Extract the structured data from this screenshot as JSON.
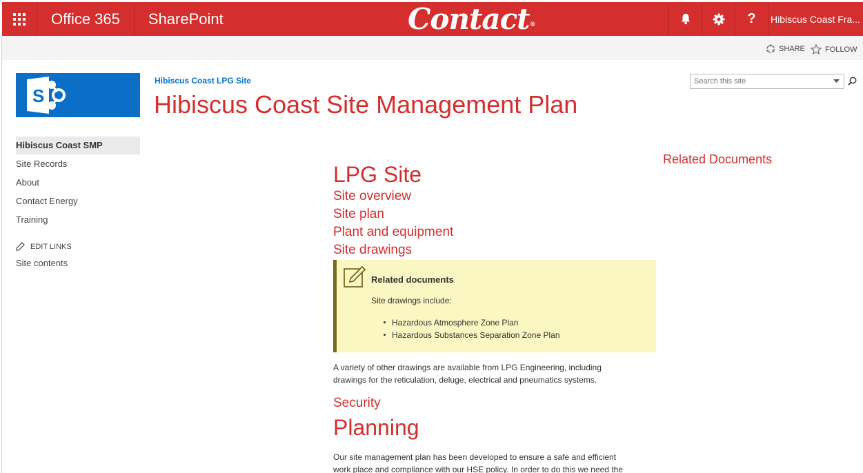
{
  "suitebar": {
    "app_launcher_icon": "waffle-icon",
    "office_label": "Office 365",
    "sharepoint_label": "SharePoint",
    "logo_text": "Contact",
    "logo_mark": "®",
    "notifications_icon": "bell-icon",
    "settings_icon": "gear-icon",
    "help_icon": "question-icon",
    "user_name": "Hibiscus Coast Fra..."
  },
  "actions": {
    "share_label": "SHARE",
    "follow_label": "FOLLOW"
  },
  "site": {
    "logo_letter": "S",
    "breadcrumb": "Hibiscus Coast LPG Site",
    "title": "Hibiscus Coast Site Management Plan"
  },
  "search": {
    "placeholder": "Search this site"
  },
  "leftnav": {
    "items": [
      {
        "label": "Hibiscus Coast SMP"
      },
      {
        "label": "Site Records"
      },
      {
        "label": "About"
      },
      {
        "label": "Contact Energy"
      },
      {
        "label": "Training"
      }
    ],
    "edit_links": "EDIT LINKS",
    "site_contents": "Site contents"
  },
  "main": {
    "heading": "LPG Site",
    "links": [
      {
        "label": "Site overview"
      },
      {
        "label": "Site plan"
      },
      {
        "label": "Plant and equipment"
      },
      {
        "label": "Site drawings"
      }
    ],
    "callout": {
      "title": "Related documents",
      "text": "Site drawings include:",
      "items": [
        "Hazardous Atmosphere Zone Plan",
        "Hazardous Substances Separation Zone Plan"
      ]
    },
    "para1_line1": "A variety of other drawings are available from LPG Engineering, including",
    "para1_line2": "drawings for the reticulation, deluge, electrical and pneumatics systems.",
    "security": "Security",
    "planning": "Planning",
    "para2_line1": "Our site management plan has been developed to ensure a safe and efficient",
    "para2_line2": "work place and compliance with our HSE policy. In order to do this we need the"
  },
  "related": {
    "title": "Related Documents"
  },
  "colors": {
    "brand_red": "#d42e2e",
    "link_blue": "#0072c6",
    "callout_bg": "#fbf7c2",
    "sharepoint_blue": "#0b6fc7"
  }
}
